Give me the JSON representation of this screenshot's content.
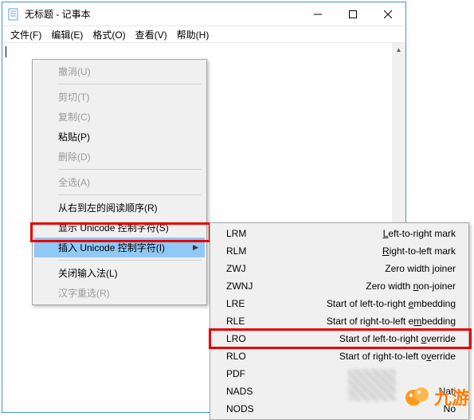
{
  "window": {
    "title": "无标题 - 记事本"
  },
  "menubar": {
    "file": "文件(F)",
    "edit": "编辑(E)",
    "format": "格式(O)",
    "view": "查看(V)",
    "help": "帮助(H)"
  },
  "context": {
    "undo": "撤消(U)",
    "cut": "剪切(T)",
    "copy": "复制(C)",
    "paste": "粘贴(P)",
    "delete": "删除(D)",
    "select_all": "全选(A)",
    "rtl_reading": "从右到左的阅读顺序(R)",
    "show_unicode": "显示 Unicode 控制字符(S)",
    "insert_unicode": "插入 Unicode 控制字符(I)",
    "close_ime": "关闭输入法(L)",
    "reconvert": "汉字重选(R)"
  },
  "unicode_items": [
    {
      "code": "LRM",
      "desc_pre": "",
      "u": "L",
      "desc_post": "eft-to-right mark"
    },
    {
      "code": "RLM",
      "desc_pre": "",
      "u": "R",
      "desc_post": "ight-to-left mark"
    },
    {
      "code": "ZWJ",
      "desc_pre": "Zero width ",
      "u": "j",
      "desc_post": "oiner"
    },
    {
      "code": "ZWNJ",
      "desc_pre": "Zero width ",
      "u": "n",
      "desc_post": "on-joiner"
    },
    {
      "code": "LRE",
      "desc_pre": "Start of left-to-right ",
      "u": "e",
      "desc_post": "mbedding"
    },
    {
      "code": "RLE",
      "desc_pre": "Start of right-to-left e",
      "u": "m",
      "desc_post": "bedding"
    },
    {
      "code": "LRO",
      "desc_pre": "Start of left-to-right ",
      "u": "o",
      "desc_post": "verride"
    },
    {
      "code": "RLO",
      "desc_pre": "Start of right-to-left o",
      "u": "v",
      "desc_post": "erride"
    },
    {
      "code": "PDF",
      "desc_pre": "",
      "u": "",
      "desc_post": ""
    },
    {
      "code": "NADS",
      "desc_pre": "Nati",
      "u": "",
      "desc_post": ""
    },
    {
      "code": "NODS",
      "desc_pre": "No",
      "u": "",
      "desc_post": ""
    }
  ],
  "watermark": {
    "text": "九游"
  }
}
